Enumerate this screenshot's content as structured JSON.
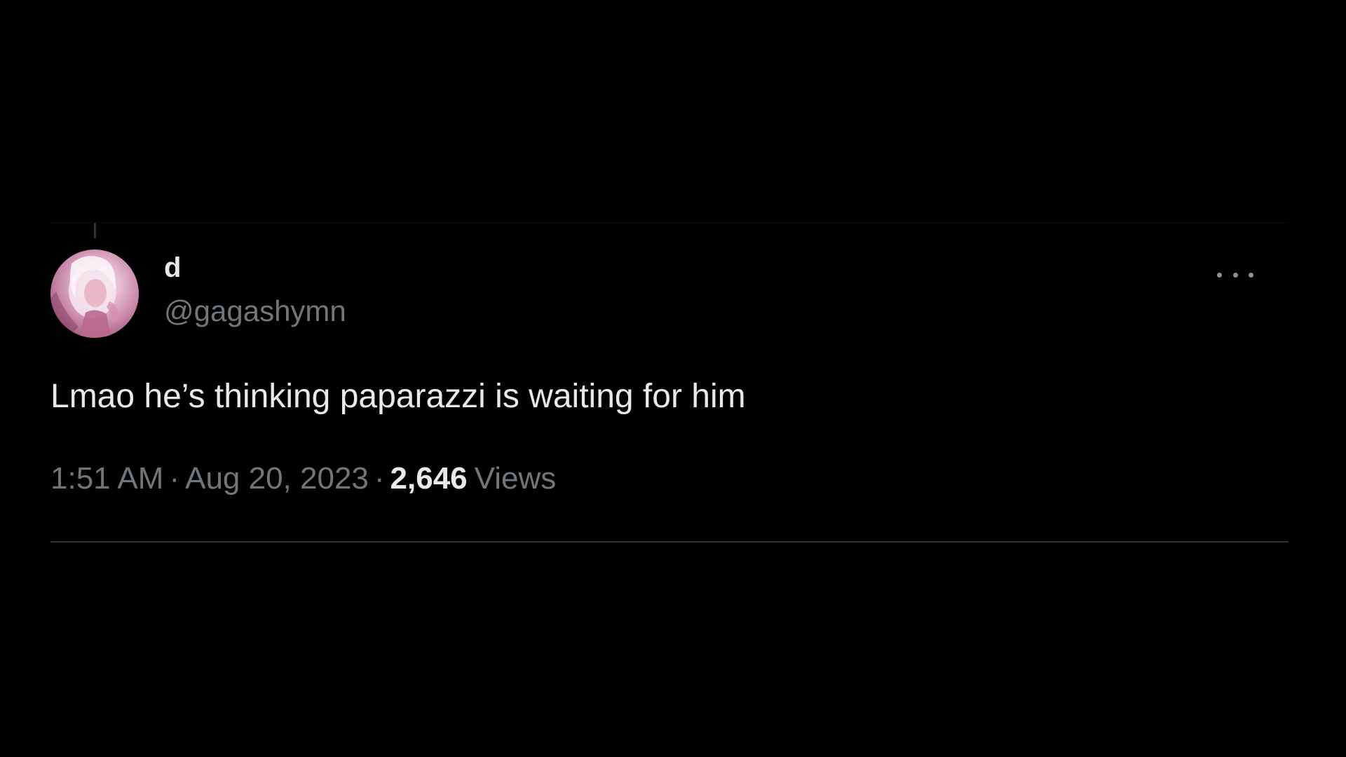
{
  "tweet": {
    "author": {
      "display_name": "d",
      "handle": "@gagashymn",
      "avatar_icon": "profile-photo"
    },
    "more_icon": "more-horizontal-icon",
    "text": "Lmao he’s thinking paparazzi is waiting for him",
    "meta": {
      "time": "1:51 AM",
      "separator": "·",
      "date": "Aug 20, 2023",
      "views_count": "2,646",
      "views_label": "Views"
    }
  },
  "colors": {
    "background": "#000000",
    "primary_text": "#e7e9ea",
    "secondary_text": "#71767b",
    "divider": "#2f3336"
  }
}
